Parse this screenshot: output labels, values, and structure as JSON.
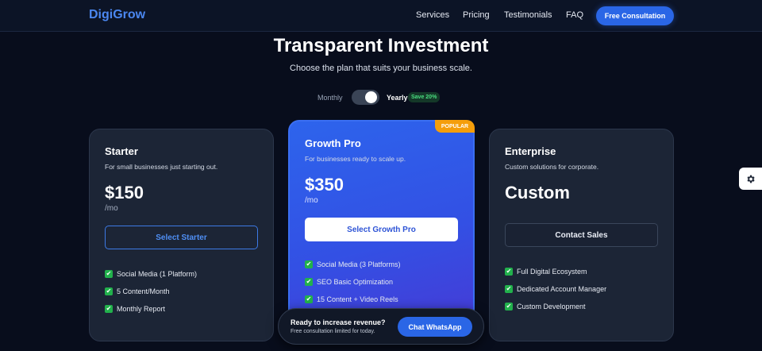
{
  "nav": {
    "logo": "DigiGrow",
    "links": [
      "Services",
      "Pricing",
      "Testimonials",
      "FAQ"
    ],
    "cta": "Free Consultation"
  },
  "hero": {
    "title": "Transparent Investment",
    "subtitle": "Choose the plan that suits your business scale."
  },
  "billing_toggle": {
    "monthly_label": "Monthly",
    "yearly_label": "Yearly",
    "save_badge": "Save 20%",
    "selected": "Yearly"
  },
  "plans": [
    {
      "name": "Starter",
      "description": "For small businesses just starting out.",
      "price": "$150",
      "period": "/mo",
      "button": "Select Starter",
      "features": [
        "Social Media (1 Platform)",
        "5 Content/Month",
        "Monthly Report"
      ]
    },
    {
      "name": "Growth Pro",
      "badge": "POPULAR",
      "description": "For businesses ready to scale up.",
      "price": "$350",
      "period": "/mo",
      "button": "Select Growth Pro",
      "features": [
        "Social Media (3 Platforms)",
        "SEO Basic Optimization",
        "15 Content + Video Reels"
      ]
    },
    {
      "name": "Enterprise",
      "description": "Custom solutions for corporate.",
      "price": "Custom",
      "button": "Contact Sales",
      "features": [
        "Full Digital Ecosystem",
        "Dedicated Account Manager",
        "Custom Development"
      ]
    }
  ],
  "floating_cta": {
    "title": "Ready to increase revenue?",
    "subtitle": "Free consultation limited for today.",
    "button": "Chat WhatsApp"
  },
  "icons": {
    "feature_check": "check-icon",
    "settings": "gear-icon",
    "check_glyph": "✔"
  },
  "colors": {
    "accent": "#2a66e6",
    "logo": "#4b87f0",
    "popular_badge": "#f59e0b",
    "check": "#22b14c",
    "save_badge_text": "#4ade80"
  }
}
